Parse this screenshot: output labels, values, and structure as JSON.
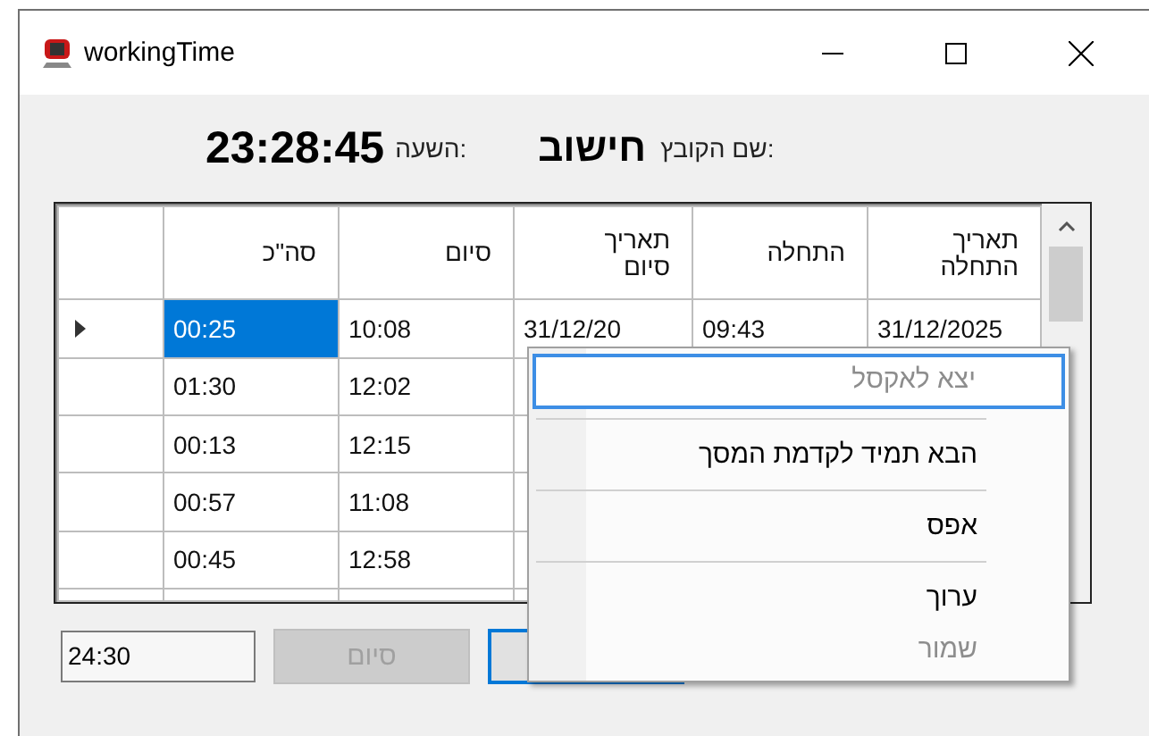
{
  "window": {
    "title": "workingTime"
  },
  "header": {
    "file_label": "שם הקובץ:",
    "file_name": "חישוב",
    "time_label": "השעה:",
    "time": "23:28:45"
  },
  "table": {
    "columns": [
      "תאריך התחלה",
      "התחלה",
      "תאריך סיום",
      "סיום",
      "סה\"כ"
    ],
    "rows": [
      {
        "current": true,
        "cells": [
          {
            "text": "31/12/2025",
            "selected": false
          },
          {
            "text": "09:43",
            "selected": false
          },
          {
            "text": "31/12/20",
            "selected": false
          },
          {
            "text": "10:08",
            "selected": false
          },
          {
            "text": "00:25",
            "selected": true
          }
        ]
      },
      {
        "current": false,
        "cells": [
          null,
          null,
          null,
          {
            "text": "12:02",
            "selected": false
          },
          {
            "text": "01:30",
            "selected": false
          }
        ]
      },
      {
        "current": false,
        "cells": [
          null,
          null,
          null,
          {
            "text": "12:15",
            "selected": false
          },
          {
            "text": "00:13",
            "selected": false
          }
        ]
      },
      {
        "current": false,
        "cells": [
          null,
          null,
          null,
          {
            "text": "11:08",
            "selected": false
          },
          {
            "text": "00:57",
            "selected": false
          }
        ]
      },
      {
        "current": false,
        "cells": [
          null,
          null,
          null,
          {
            "text": "12:58",
            "selected": false
          },
          {
            "text": "00:45",
            "selected": false
          }
        ]
      }
    ]
  },
  "total_field": {
    "value": "24:30"
  },
  "buttons": [
    {
      "label": "סיום",
      "disabled": true,
      "focused": false
    },
    {
      "disabled": false,
      "focused": true
    }
  ],
  "context_menu": [
    {
      "kind": "item",
      "label": "יצא לאקסל",
      "disabled": true,
      "selected": true
    },
    {
      "kind": "separator"
    },
    {
      "kind": "item",
      "label": "הבא תמיד לקדמת המסך",
      "disabled": false,
      "selected": false
    },
    {
      "kind": "separator"
    },
    {
      "kind": "item",
      "label": "אפס",
      "disabled": false,
      "selected": false
    },
    {
      "kind": "separator"
    },
    {
      "kind": "item",
      "label": "ערוך",
      "disabled": false,
      "selected": false
    },
    {
      "kind": "item",
      "label": "שמור",
      "disabled": true,
      "selected": false
    }
  ]
}
